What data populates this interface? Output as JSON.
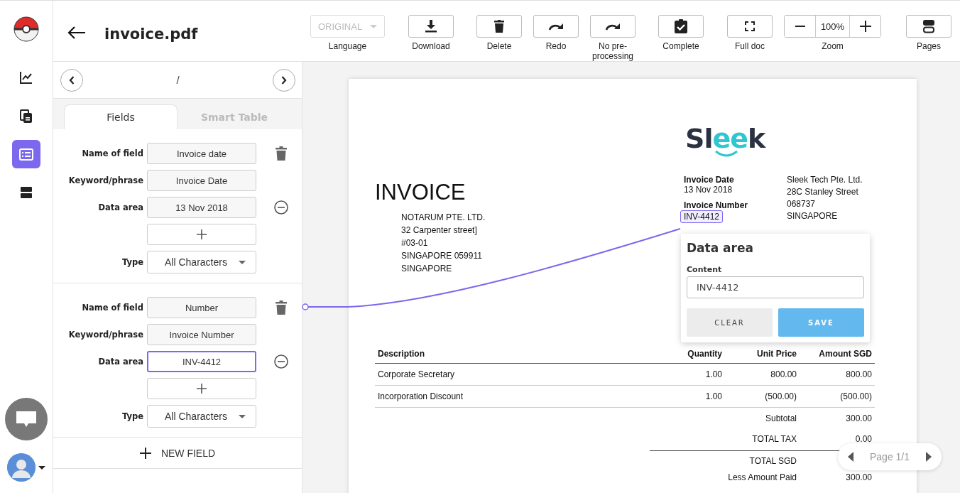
{
  "rail": {
    "items": [
      {
        "kind": "chart",
        "selected": false
      },
      {
        "kind": "documents",
        "selected": false
      },
      {
        "kind": "form",
        "selected": true
      },
      {
        "kind": "pages",
        "selected": false
      }
    ]
  },
  "header": {
    "title": "invoice.pdf"
  },
  "toolbar": [
    {
      "kind": "select",
      "value": "ORIGINAL",
      "label": "Language",
      "disabled": true
    },
    {
      "kind": "download",
      "label": "Download"
    },
    {
      "kind": "delete",
      "label": "Delete"
    },
    {
      "kind": "redo",
      "label": "Redo"
    },
    {
      "kind": "redo",
      "label": "No pre-processing"
    },
    {
      "kind": "complete",
      "label": "Complete"
    },
    {
      "kind": "fullscreen",
      "label": "Full doc"
    },
    {
      "kind": "zoom",
      "value": "100%",
      "label": "Zoom"
    },
    {
      "kind": "pages",
      "label": "Pages"
    }
  ],
  "navigator": {
    "text": "/"
  },
  "tabs": [
    {
      "label": "Fields",
      "selected": true
    },
    {
      "label": "Smart Table",
      "selected": false
    }
  ],
  "fields": [
    {
      "name_label": "Name of field",
      "name": "Invoice date",
      "keyword_label": "Keyword/phrase",
      "keyword": "Invoice Date",
      "data_area_label": "Data area",
      "data_area": "13 Nov 2018",
      "focused": false,
      "type_label": "Type",
      "type": "All Characters"
    },
    {
      "name_label": "Name of field",
      "name": "Number",
      "keyword_label": "Keyword/phrase",
      "keyword": "Invoice Number",
      "data_area_label": "Data area",
      "data_area": "INV-4412",
      "focused": true,
      "type_label": "Type",
      "type": "All Characters"
    }
  ],
  "new_field": "NEW FIELD",
  "document": {
    "logo": "Sleek",
    "title": "INVOICE",
    "bill_to": [
      "NOTARUM PTE. LTD.",
      "32 Carpenter street]",
      "#03-01",
      "SINGAPORE 059911",
      "SINGAPORE"
    ],
    "meta": [
      {
        "label": "Invoice Date",
        "value": "13 Nov 2018",
        "highlighted": false
      },
      {
        "label": "Invoice Number",
        "value": "INV-4412",
        "highlighted": true
      }
    ],
    "company": [
      "Sleek Tech Pte. Ltd.",
      "28C Stanley Street",
      "068737",
      "SINGAPORE"
    ],
    "columns": [
      "Description",
      "Quantity",
      "Unit Price",
      "Amount SGD"
    ],
    "rows": [
      [
        "Corporate Secretary",
        "1.00",
        "800.00",
        "800.00"
      ],
      [
        "Incorporation Discount",
        "1.00",
        "(500.00)",
        "(500.00)"
      ]
    ],
    "totals": [
      {
        "label": "Subtotal",
        "value": "300.00",
        "rule_above": false
      },
      {
        "label": "TOTAL  TAX",
        "value": "0.00",
        "rule_above": false
      },
      {
        "label": "TOTAL SGD",
        "rule_above": true
      },
      {
        "label": "Less Amount Paid",
        "value": "300.00",
        "rule_above": false
      }
    ]
  },
  "popup": {
    "title": "Data area",
    "content_label": "Content",
    "content": "INV-4412",
    "buttons": [
      {
        "kind": "secondary",
        "label": "CLEAR"
      },
      {
        "kind": "primary",
        "label": "SAVE"
      }
    ]
  },
  "pager": {
    "text": "Page 1/1"
  }
}
